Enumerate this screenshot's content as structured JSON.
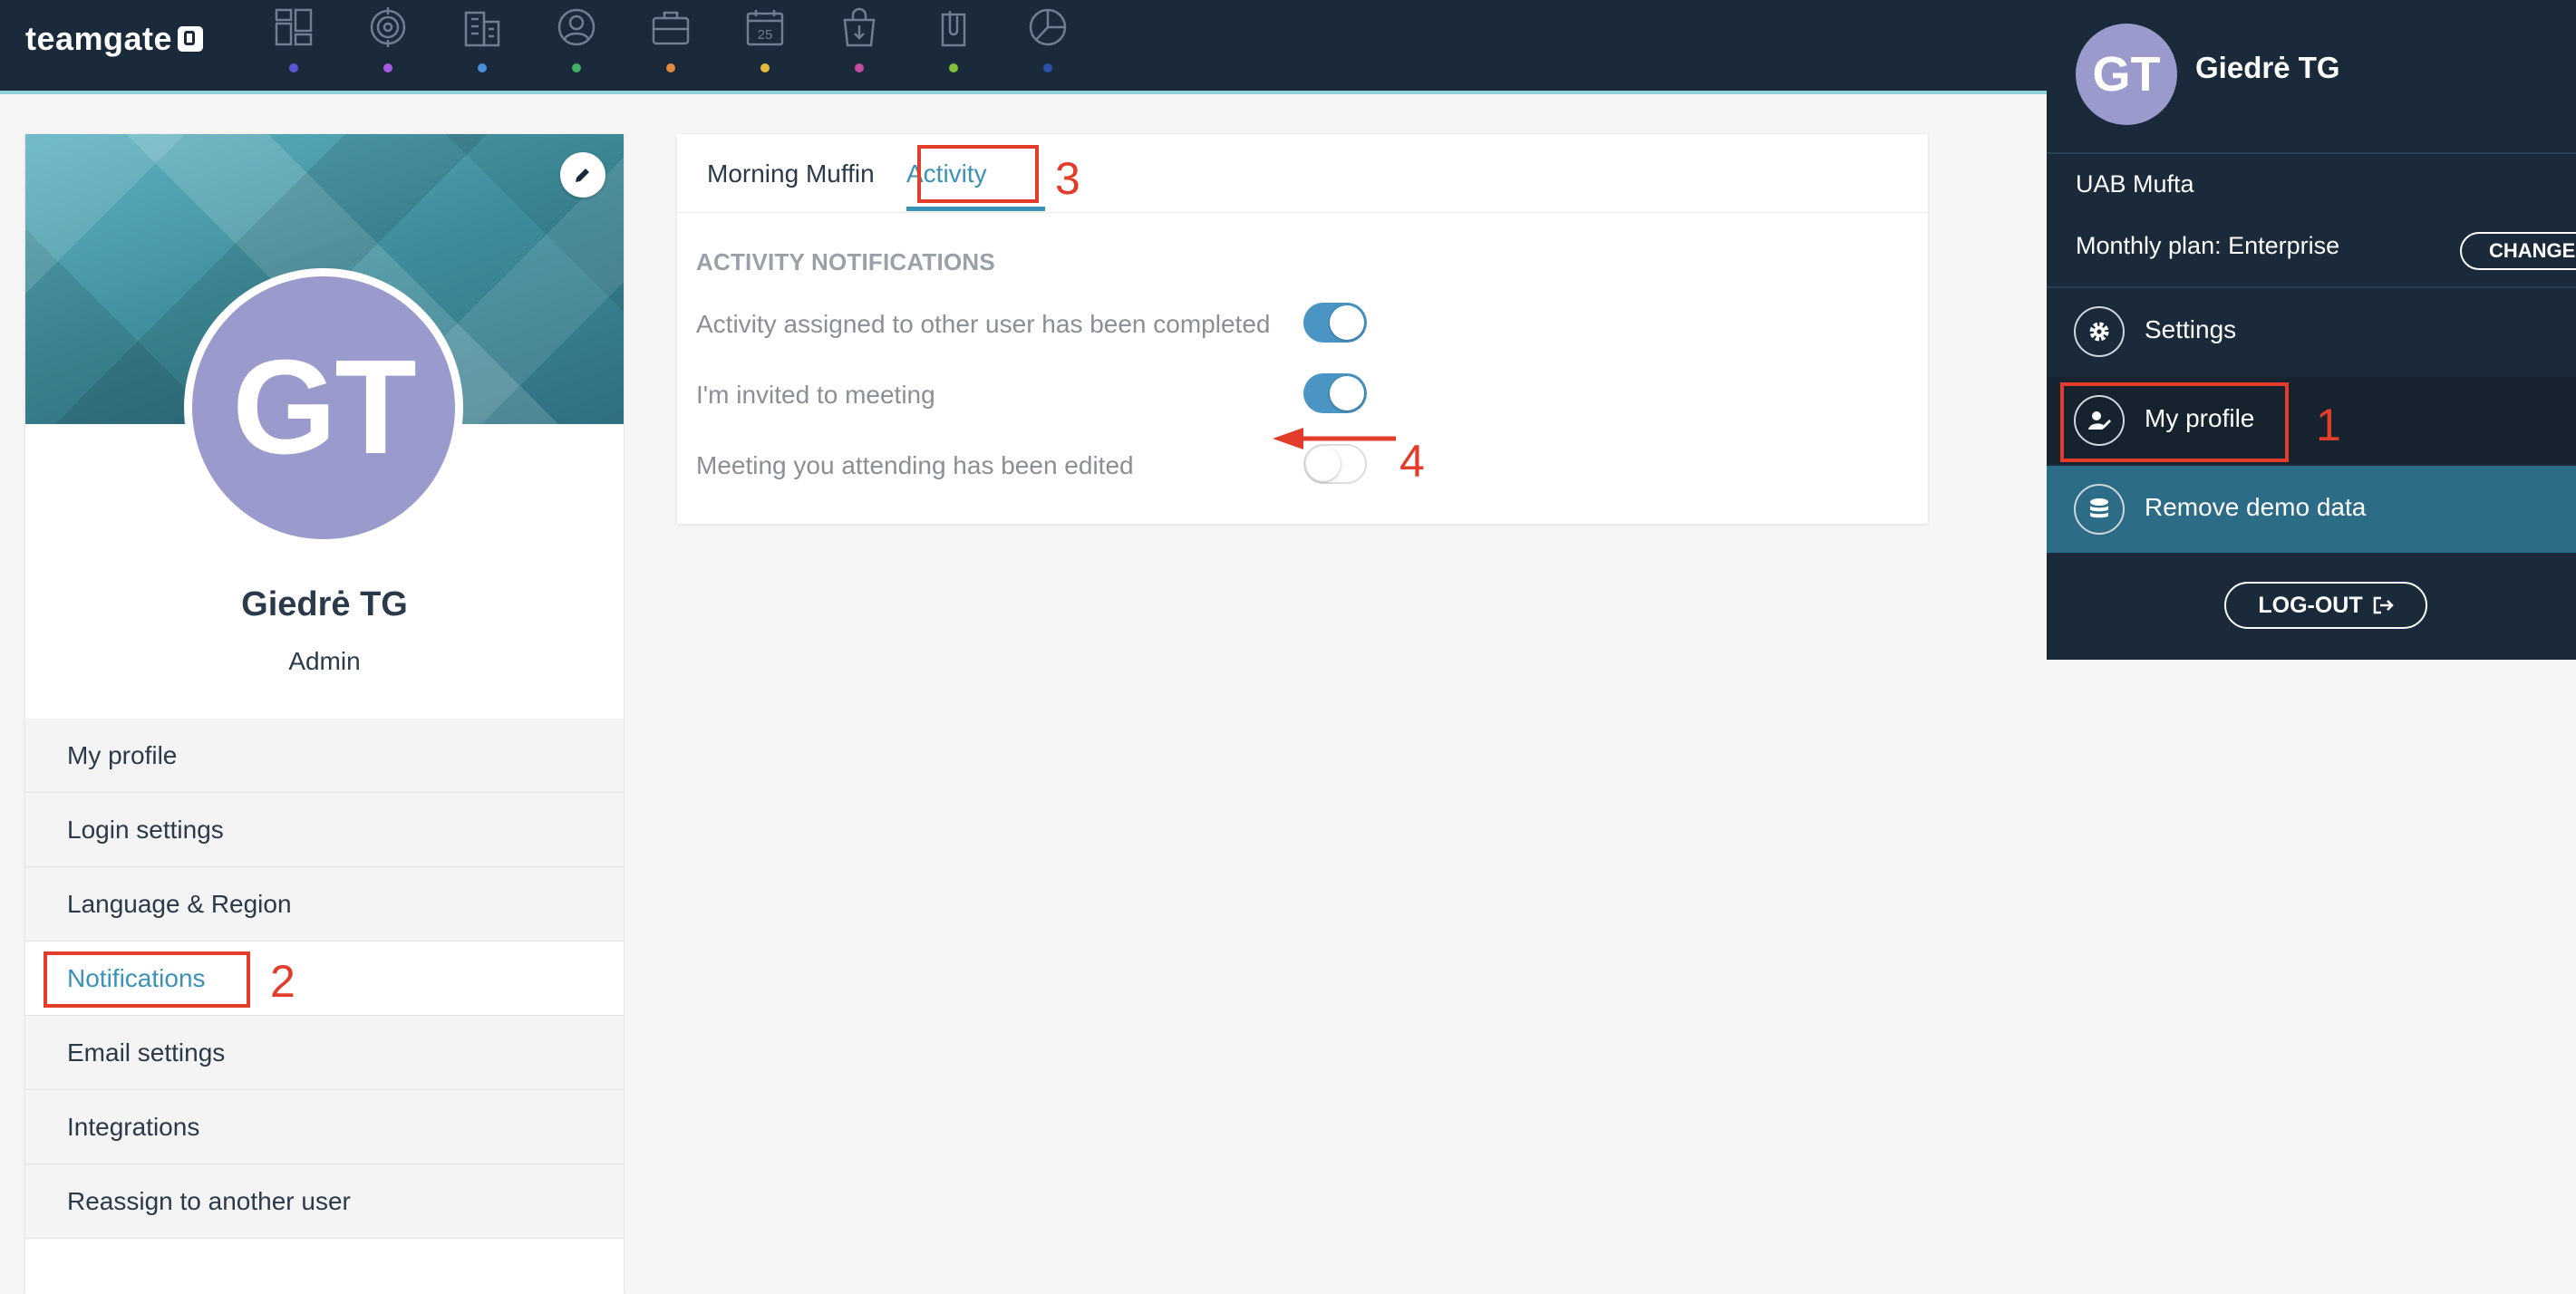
{
  "app": {
    "logo_text": "teamgate"
  },
  "nav": {
    "items": [
      {
        "name": "dashboard-icon",
        "dot_color": "#5a57d6"
      },
      {
        "name": "target-icon",
        "dot_color": "#a45be0"
      },
      {
        "name": "companies-icon",
        "dot_color": "#4a8fd8"
      },
      {
        "name": "people-icon",
        "dot_color": "#3fb265"
      },
      {
        "name": "deals-icon",
        "dot_color": "#e08a3b"
      },
      {
        "name": "calendar-icon",
        "dot_color": "#e0b93b"
      },
      {
        "name": "sales-icon",
        "dot_color": "#c84aa0"
      },
      {
        "name": "attachments-icon",
        "dot_color": "#7fc23a"
      },
      {
        "name": "reports-icon",
        "dot_color": "#2a4fa8"
      }
    ],
    "calendar_day": "25"
  },
  "profile": {
    "initials": "GT",
    "name": "Giedrė TG",
    "role": "Admin",
    "menu": [
      {
        "label": "My profile",
        "active": false
      },
      {
        "label": "Login settings",
        "active": false
      },
      {
        "label": "Language & Region",
        "active": false
      },
      {
        "label": "Notifications",
        "active": true
      },
      {
        "label": "Email settings",
        "active": false
      },
      {
        "label": "Integrations",
        "active": false
      },
      {
        "label": "Reassign to another user",
        "active": false
      }
    ]
  },
  "panel": {
    "tabs": [
      {
        "label": "Morning Muffin",
        "active": false
      },
      {
        "label": "Activity",
        "active": true
      }
    ],
    "section_title": "ACTIVITY NOTIFICATIONS",
    "settings": [
      {
        "label": "Activity assigned to other user has been completed",
        "enabled": true
      },
      {
        "label": "I'm invited to meeting",
        "enabled": true
      },
      {
        "label": "Meeting you attending has been edited",
        "enabled": false
      }
    ]
  },
  "dropdown": {
    "initials": "GT",
    "name": "Giedrė TG",
    "company": "UAB Mufta",
    "plan": "Monthly plan: Enterprise",
    "change_label": "CHANGE",
    "settings_label": "Settings",
    "my_profile_label": "My profile",
    "remove_demo_label": "Remove demo data",
    "logout_label": "LOG-OUT"
  },
  "annotations": {
    "step1": "1",
    "step2": "2",
    "step3": "3",
    "step4": "4",
    "color": "#e23c2b"
  }
}
